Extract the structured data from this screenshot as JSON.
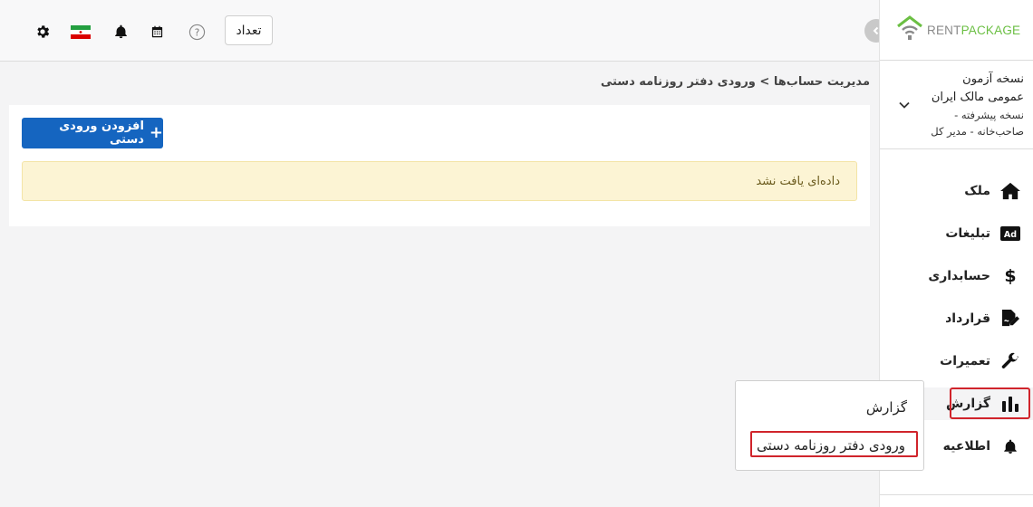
{
  "brand": {
    "part1": "RENT",
    "part2": "PACKAGE",
    "color_rent": "#8a8a8a",
    "color_package": "#6bbf43"
  },
  "header": {
    "count_button_label": "تعداد",
    "icons": [
      "gear-icon",
      "iran-flag-icon",
      "bell-icon",
      "calendar-icon",
      "help-icon"
    ]
  },
  "account": {
    "line1": "نسخه آزمون",
    "line2": "عمومی مالک ایران",
    "line3": "نسخه پیشرفته -",
    "line4": "صاحب‌خانه - مدیر کل"
  },
  "sidebar": {
    "items": [
      {
        "label": "ملک",
        "icon": "home-icon"
      },
      {
        "label": "تبلیغات",
        "icon": "ad-icon"
      },
      {
        "label": "حسابداری",
        "icon": "dollar-icon"
      },
      {
        "label": "قرارداد",
        "icon": "contract-icon"
      },
      {
        "label": "تعمیرات",
        "icon": "wrench-icon"
      },
      {
        "label": "گزارش",
        "icon": "chart-icon",
        "active": true
      },
      {
        "label": "اطلاعیه",
        "icon": "bell-icon"
      }
    ]
  },
  "breadcrumb": {
    "parent": "مدیریت حساب‌ها",
    "separator": ">",
    "current": "ورودی دفتر روزنامه دستی"
  },
  "main": {
    "add_button_label": "افزودن ورودی دستی",
    "empty_message": "داده‌ای یافت نشد"
  },
  "submenu": {
    "items": [
      {
        "label": "گزارش"
      },
      {
        "label": "ورودی دفتر روزنامه دستی",
        "highlighted": true
      }
    ]
  },
  "colors": {
    "primary": "#1565c0",
    "highlight_border": "#d0242b",
    "alert_bg": "#fcf4d4"
  }
}
